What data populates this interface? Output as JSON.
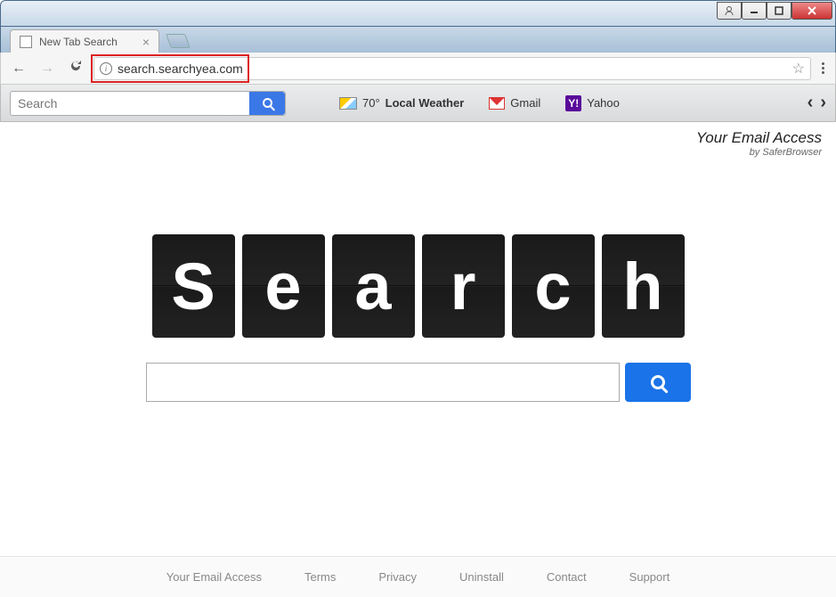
{
  "window": {
    "tab_title": "New Tab Search"
  },
  "toolbar": {
    "address": "search.searchyea.com"
  },
  "extbar": {
    "search_placeholder": "Search",
    "links": {
      "weather_temp": "70°",
      "weather_label": "Local Weather",
      "gmail": "Gmail",
      "yahoo": "Yahoo"
    }
  },
  "branding": {
    "title": "Your Email Access",
    "subtitle": "by SaferBrowser"
  },
  "main": {
    "logo_letters": [
      "S",
      "e",
      "a",
      "r",
      "c",
      "h"
    ],
    "input_value": ""
  },
  "footer": {
    "links": [
      "Your Email Access",
      "Terms",
      "Privacy",
      "Uninstall",
      "Contact",
      "Support"
    ]
  }
}
